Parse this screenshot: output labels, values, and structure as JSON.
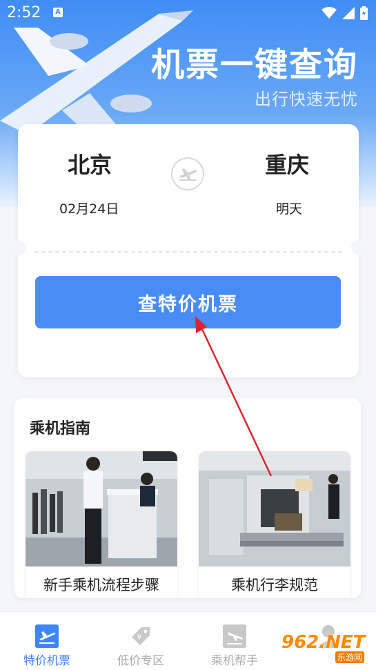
{
  "status_bar": {
    "time": "2:52",
    "notice_icon": "a-notification-icon"
  },
  "hero": {
    "title": "机票一键查询",
    "subtitle": "出行快速无忧"
  },
  "search": {
    "from_city": "北京",
    "to_city": "重庆",
    "from_date": "02月24日",
    "to_date": "明天",
    "button_label": "查特价机票"
  },
  "guide": {
    "title": "乘机指南",
    "items": [
      {
        "label": "新手乘机流程步骤"
      },
      {
        "label": "乘机行李规范"
      }
    ]
  },
  "tabbar": {
    "items": [
      {
        "label": "特价机票",
        "icon": "plane-takeoff-icon",
        "active": true
      },
      {
        "label": "低价专区",
        "icon": "price-tag-icon",
        "active": false
      },
      {
        "label": "乘机帮手",
        "icon": "boarding-icon",
        "active": false
      },
      {
        "label": "",
        "icon": "user-icon",
        "active": false
      }
    ]
  },
  "watermark": {
    "text": "962.NET",
    "sub": "乐游网"
  },
  "colors": {
    "accent": "#4a8cf6",
    "active_tab": "#3f86f5",
    "annotation_arrow": "#d8262e"
  }
}
